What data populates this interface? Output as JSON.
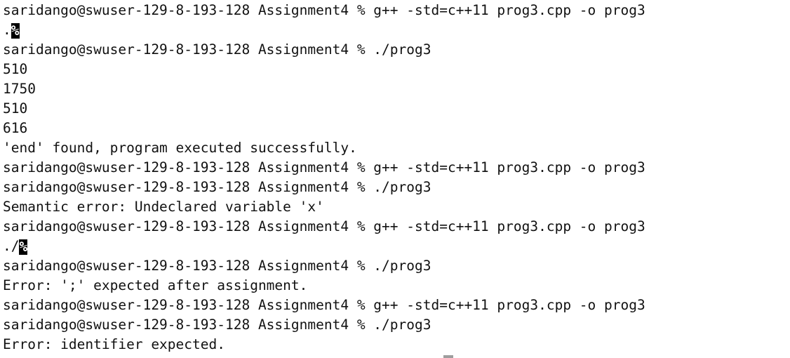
{
  "terminal": {
    "lines": [
      {
        "type": "command",
        "text": "saridango@swuser-129-8-193-128 Assignment4 % g++ -std=c++11 prog3.cpp -o prog3"
      },
      {
        "type": "output",
        "text": ".",
        "cursor": "%"
      },
      {
        "type": "command",
        "text": "saridango@swuser-129-8-193-128 Assignment4 % ./prog3"
      },
      {
        "type": "output",
        "text": "510"
      },
      {
        "type": "output",
        "text": "1750"
      },
      {
        "type": "output",
        "text": "510"
      },
      {
        "type": "output",
        "text": "616"
      },
      {
        "type": "output",
        "text": "'end' found, program executed successfully."
      },
      {
        "type": "command",
        "text": "saridango@swuser-129-8-193-128 Assignment4 % g++ -std=c++11 prog3.cpp -o prog3"
      },
      {
        "type": "command",
        "text": "saridango@swuser-129-8-193-128 Assignment4 % ./prog3"
      },
      {
        "type": "output",
        "text": "Semantic error: Undeclared variable 'x'"
      },
      {
        "type": "command",
        "text": "saridango@swuser-129-8-193-128 Assignment4 % g++ -std=c++11 prog3.cpp -o prog3"
      },
      {
        "type": "output",
        "text": "./",
        "cursor": "%"
      },
      {
        "type": "command",
        "text": "saridango@swuser-129-8-193-128 Assignment4 % ./prog3"
      },
      {
        "type": "output",
        "text": "Error: ';' expected after assignment."
      },
      {
        "type": "command",
        "text": "saridango@swuser-129-8-193-128 Assignment4 % g++ -std=c++11 prog3.cpp -o prog3"
      },
      {
        "type": "command",
        "text": "saridango@swuser-129-8-193-128 Assignment4 % ./prog3"
      },
      {
        "type": "output",
        "text": "Error: identifier expected."
      }
    ]
  }
}
